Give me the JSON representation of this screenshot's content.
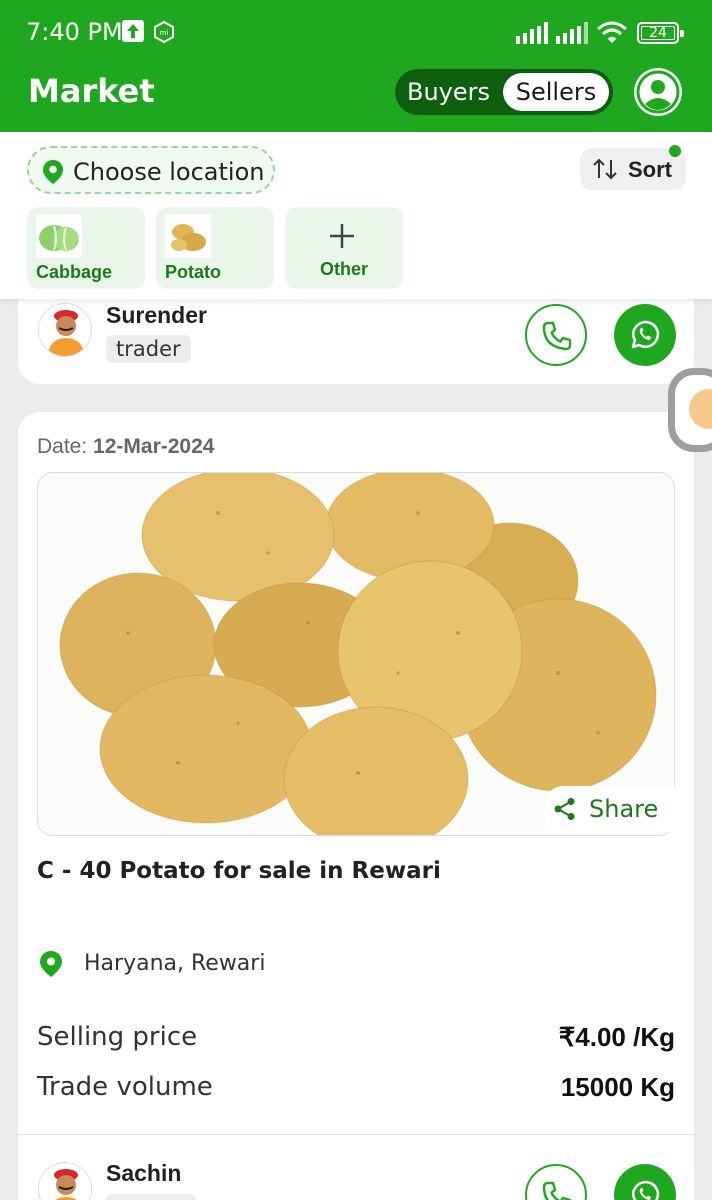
{
  "status_bar": {
    "time": "7:40 PM",
    "battery": "24"
  },
  "header": {
    "title": "Market",
    "toggle": {
      "buyers_label": "Buyers",
      "sellers_label": "Sellers",
      "selected": "Sellers"
    },
    "profile_icon": "account-circle-icon"
  },
  "filters": {
    "location_label": "Choose location",
    "sort_label": "Sort",
    "chips": [
      {
        "label": "Cabbage",
        "icon": "cabbage-image"
      },
      {
        "label": "Potato",
        "icon": "potato-image"
      },
      {
        "label": "Other",
        "icon": "plus-icon"
      }
    ]
  },
  "listings": [
    {
      "seller_name": "Surender",
      "seller_tag": "trader"
    },
    {
      "date_label": "Date:",
      "date_value": "12-Mar-2024",
      "share_label": "Share",
      "title": "C - 40 Potato for sale in Rewari",
      "location": "Haryana, Rewari",
      "price_label": "Selling price",
      "price_value": "₹4.00 /Kg",
      "volume_label": "Trade volume",
      "volume_value": "15000 Kg",
      "seller_name": "Sachin"
    }
  ],
  "colors": {
    "brand_green": "#1fa81f",
    "dark_green": "#0d5e0d",
    "chip_bg": "#e9f6e9"
  }
}
